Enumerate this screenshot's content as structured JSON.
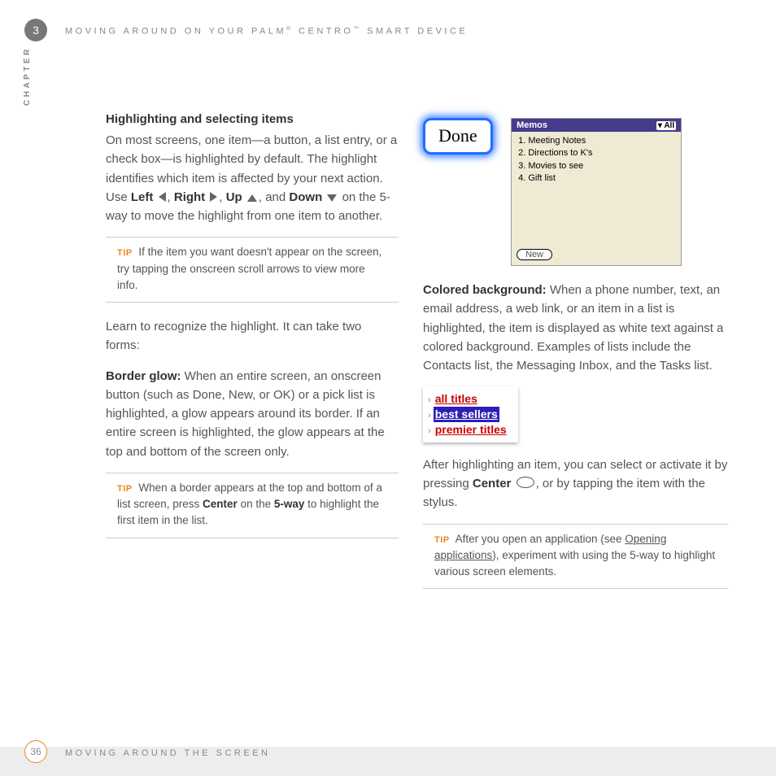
{
  "header": {
    "chapter_number": "3",
    "chapter_label": "CHAPTER",
    "title": "MOVING AROUND ON YOUR PALM® CENTRO™ SMART DEVICE"
  },
  "section": {
    "heading": "Highlighting and selecting items",
    "para1_a": "On most screens, one item—a button, a list entry, or a check box—is highlighted by default. The highlight identifies which item is affected by your next action. Use ",
    "left": "Left",
    "right": "Right",
    "up": "Up",
    "down": "Down",
    "para1_b": " on the 5-way to move the highlight from one item to another.",
    "tip1": "If the item you want doesn't appear on the screen, try tapping the onscreen scroll arrows to view more info.",
    "para2": "Learn to recognize the highlight. It can take two forms:",
    "border_glow_label": "Border glow:",
    "border_glow_text": " When an entire screen, an onscreen button (such as Done, New, or OK) or a pick list is highlighted, a glow appears around its border. If an entire screen is highlighted, the glow appears at the top and bottom of the screen only.",
    "tip2_a": "When a border appears at the top and bottom of a list screen, press ",
    "tip2_center": "Center",
    "tip2_b": " on the ",
    "tip2_5way": "5-way",
    "tip2_c": " to highlight the first item in the list."
  },
  "right_col": {
    "done_label": "Done",
    "memos_title": "Memos",
    "memos_all": "▾ All",
    "memos_items": [
      "1. Meeting Notes",
      "2. Directions to K's",
      "3. Movies to see",
      "4. Gift list"
    ],
    "new_button": "New",
    "colored_bg_label": "Colored background:",
    "colored_bg_text": " When a phone number, text, an email address, a web link, or an item in a list is highlighted, the item is displayed as white text against a colored background. Examples of lists include the Contacts list, the Messaging Inbox, and the Tasks list.",
    "picker": {
      "item1": "all titles",
      "item2": "best sellers",
      "item3": "premier titles"
    },
    "after_para_a": "After highlighting an item, you can select or activate it by pressing ",
    "after_center": "Center",
    "after_para_b": ", or by tapping the item with the stylus.",
    "tip3_a": "After you open an application (see ",
    "tip3_link": "Opening applications",
    "tip3_b": "), experiment with using the 5-way to highlight various screen elements."
  },
  "footer": {
    "page": "36",
    "title": "MOVING AROUND THE SCREEN"
  },
  "tip_label": "TIP"
}
